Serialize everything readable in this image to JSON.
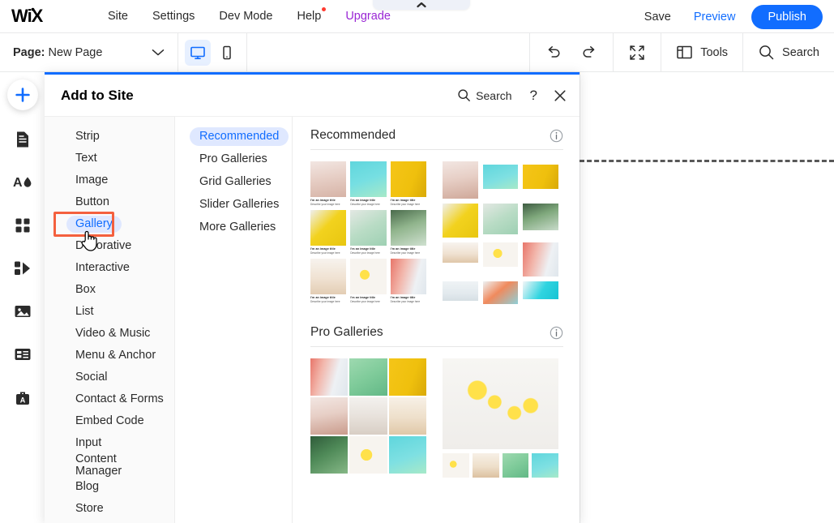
{
  "app": {
    "logo": "WiX"
  },
  "topbar": {
    "nav": [
      {
        "label": "Site",
        "name": "site"
      },
      {
        "label": "Settings",
        "name": "settings"
      },
      {
        "label": "Dev Mode",
        "name": "dev-mode"
      },
      {
        "label": "Help",
        "name": "help",
        "badge": true
      },
      {
        "label": "Upgrade",
        "name": "upgrade",
        "accent": "#9a27d5"
      }
    ],
    "save_label": "Save",
    "preview_label": "Preview",
    "publish_label": "Publish",
    "publish_color": "#116dff",
    "collapse_icon": "chevron-up-icon"
  },
  "secondbar": {
    "page_prefix": "Page:",
    "page_name": "New Page",
    "page_chevron": "chevron-down-icon",
    "viewmodes": [
      {
        "name": "desktop-view",
        "icon": "monitor-icon",
        "active": true
      },
      {
        "name": "mobile-view",
        "icon": "mobile-icon",
        "active": false
      }
    ],
    "undo_icon": "undo-icon",
    "redo_icon": "redo-icon",
    "zoomout_icon": "zoom-out-icon",
    "tools_label": "Tools",
    "tools_icon": "layout-panel-icon",
    "search_label": "Search",
    "search_icon": "search-icon"
  },
  "leftrail": {
    "add_icon": "plus-icon",
    "items": [
      {
        "name": "pages",
        "icon": "page-icon"
      },
      {
        "name": "theme-design",
        "icon": "text-and-color-icon"
      },
      {
        "name": "apps",
        "icon": "four-squares-icon"
      },
      {
        "name": "add-ons",
        "icon": "puzzle-icon"
      },
      {
        "name": "media",
        "icon": "image-icon"
      },
      {
        "name": "blog",
        "icon": "layout-table-icon"
      },
      {
        "name": "business-tools",
        "icon": "briefcase-icon"
      }
    ]
  },
  "panel": {
    "title": "Add to Site",
    "search_label": "Search",
    "search_icon": "search-icon",
    "help_label": "?",
    "close_icon": "close-icon",
    "categories": [
      {
        "label": "Strip",
        "selected": false
      },
      {
        "label": "Text",
        "selected": false
      },
      {
        "label": "Image",
        "selected": false
      },
      {
        "label": "Button",
        "selected": false
      },
      {
        "label": "Gallery",
        "selected": true
      },
      {
        "label": "Decorative",
        "selected": false
      },
      {
        "label": "Interactive",
        "selected": false
      },
      {
        "label": "Box",
        "selected": false
      },
      {
        "label": "List",
        "selected": false
      },
      {
        "label": "Video & Music",
        "selected": false
      },
      {
        "label": "Menu & Anchor",
        "selected": false
      },
      {
        "label": "Social",
        "selected": false
      },
      {
        "label": "Contact & Forms",
        "selected": false
      },
      {
        "label": "Embed Code",
        "selected": false
      },
      {
        "label": "Input",
        "selected": false
      },
      {
        "label": "Content Manager",
        "selected": false
      },
      {
        "label": "Blog",
        "selected": false
      },
      {
        "label": "Store",
        "selected": false
      }
    ],
    "subcategories": [
      {
        "label": "Recommended",
        "selected": true
      },
      {
        "label": "Pro Galleries",
        "selected": false
      },
      {
        "label": "Grid Galleries",
        "selected": false
      },
      {
        "label": "Slider Galleries",
        "selected": false
      },
      {
        "label": "More Galleries",
        "selected": false
      }
    ],
    "sections": [
      {
        "title": "Recommended",
        "info_icon": "info-icon",
        "items": [
          {
            "name": "grid-gallery-with-captions",
            "layout": "captioned-grid",
            "caption_title": "I'm an image title",
            "caption_desc": "Describe your image here"
          },
          {
            "name": "masonry-gallery",
            "layout": "masonry"
          }
        ]
      },
      {
        "title": "Pro Galleries",
        "info_icon": "info-icon",
        "items": [
          {
            "name": "pro-grid-gallery",
            "layout": "tight-grid"
          },
          {
            "name": "pro-slider-gallery",
            "layout": "slider"
          }
        ]
      }
    ]
  },
  "annotation": {
    "target": "Gallery",
    "color": "#f4603e"
  },
  "cursor": {
    "type": "pointing-hand-cursor"
  }
}
